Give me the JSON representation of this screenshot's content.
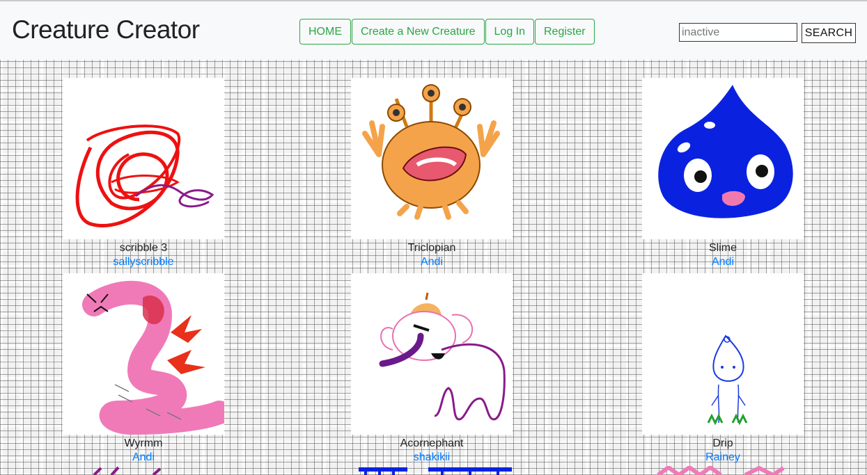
{
  "brand": "Creature Creator",
  "nav": {
    "home": "HOME",
    "create": "Create a New Creature",
    "login": "Log In",
    "register": "Register"
  },
  "search": {
    "value": "inactive",
    "button": "SEARCH"
  },
  "creatures": [
    {
      "name": "scribble 3",
      "user": "sallyscribble"
    },
    {
      "name": "Triclopian",
      "user": "Andi"
    },
    {
      "name": "Slime",
      "user": "Andi"
    },
    {
      "name": "Wyrmm",
      "user": "Andi"
    },
    {
      "name": "Acornephant",
      "user": "shakikii"
    },
    {
      "name": "Drip",
      "user": "Rainey"
    }
  ],
  "colors": {
    "accent_green": "#28a745",
    "link_blue": "#007bff"
  }
}
